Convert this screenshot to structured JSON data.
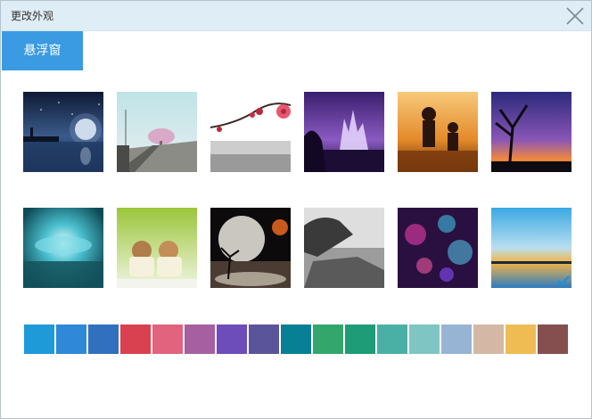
{
  "dialog": {
    "title": "更改外观",
    "close_icon": "close-icon"
  },
  "tabs": [
    {
      "label": "悬浮窗",
      "active": true
    }
  ],
  "wallpapers": [
    {
      "name": "night-moon-lake"
    },
    {
      "name": "railway-tree"
    },
    {
      "name": "plum-blossom"
    },
    {
      "name": "purple-castle"
    },
    {
      "name": "couple-sunset"
    },
    {
      "name": "tree-silhouette-dusk"
    },
    {
      "name": "teal-crater-lake"
    },
    {
      "name": "bunnies-in-cups"
    },
    {
      "name": "planet-tree-fantasy"
    },
    {
      "name": "bw-tree-shore"
    },
    {
      "name": "bokeh-lights"
    },
    {
      "name": "sky-lake-reflection",
      "selected": true
    }
  ],
  "swatches": [
    "#1f9ad9",
    "#2f88d8",
    "#3070be",
    "#d94150",
    "#e2637e",
    "#a65fa0",
    "#6c4dba",
    "#5a549a",
    "#077f94",
    "#33a66c",
    "#1e9c78",
    "#4ab0a6",
    "#7ec5c3",
    "#98b4d4",
    "#d4b8a5",
    "#efbb53",
    "#844f4e"
  ]
}
